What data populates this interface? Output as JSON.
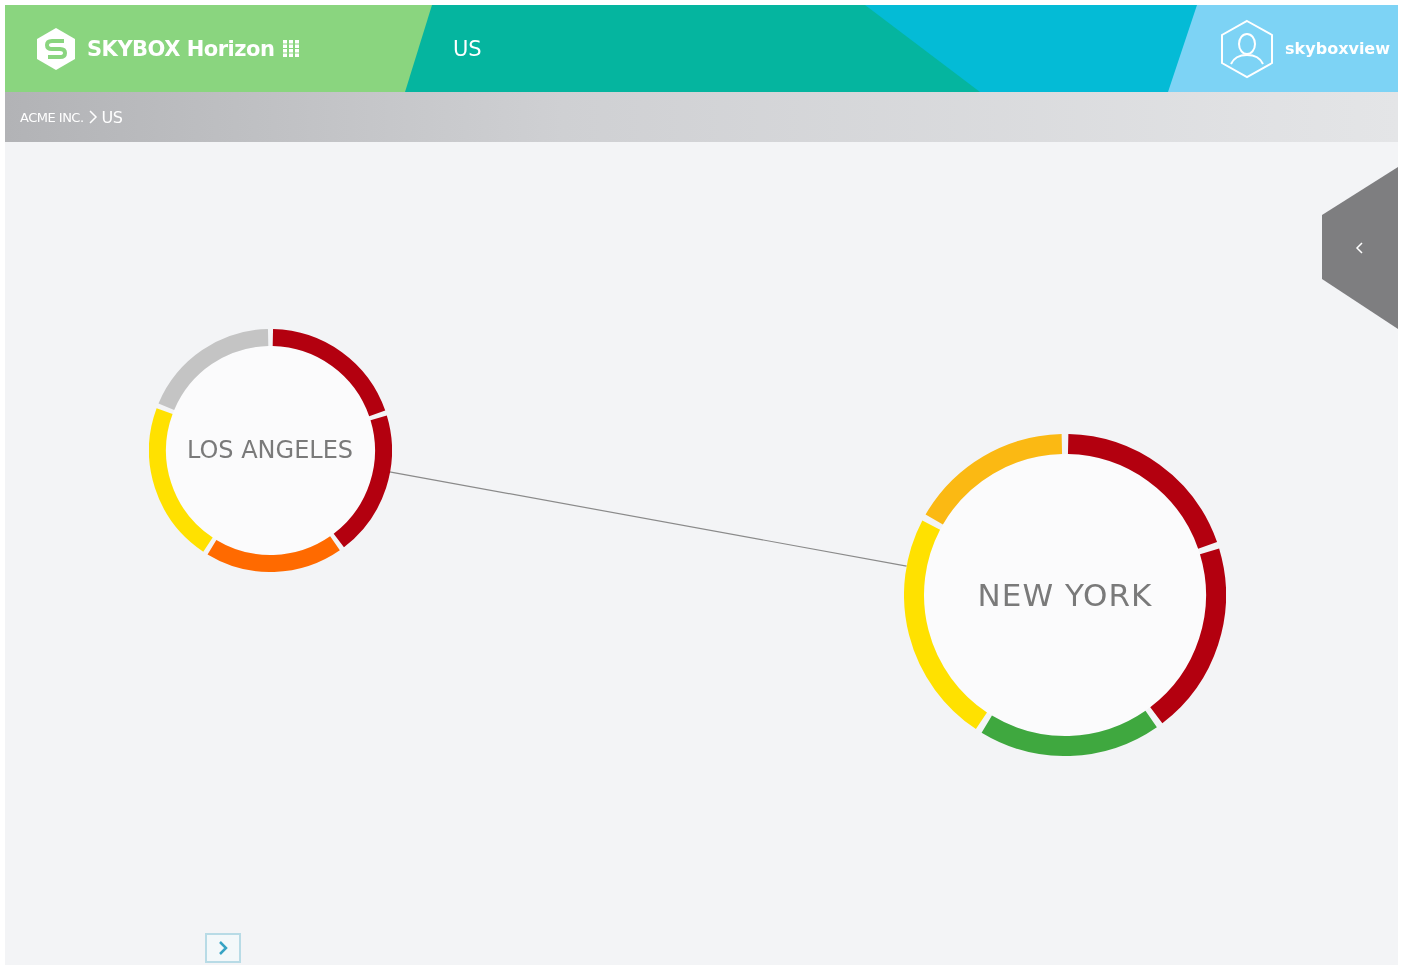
{
  "header": {
    "brand": "SKYBOX Horizon",
    "title": "US",
    "user": "skyboxview"
  },
  "breadcrumb": [
    "ACME INC.",
    "US"
  ],
  "map": {
    "nodes": [
      {
        "name": "LOS ANGELES",
        "segments": [
          {
            "color": "#b3000f"
          },
          {
            "color": "#b3000f"
          },
          {
            "color": "#ff6a00"
          },
          {
            "color": "#ffe100"
          },
          {
            "color": "#c4c4c4"
          }
        ]
      },
      {
        "name": "NEW YORK",
        "segments": [
          {
            "color": "#b3000f"
          },
          {
            "color": "#b3000f"
          },
          {
            "color": "#3fa83f"
          },
          {
            "color": "#ffe100"
          },
          {
            "color": "#fbb913"
          }
        ]
      }
    ]
  }
}
